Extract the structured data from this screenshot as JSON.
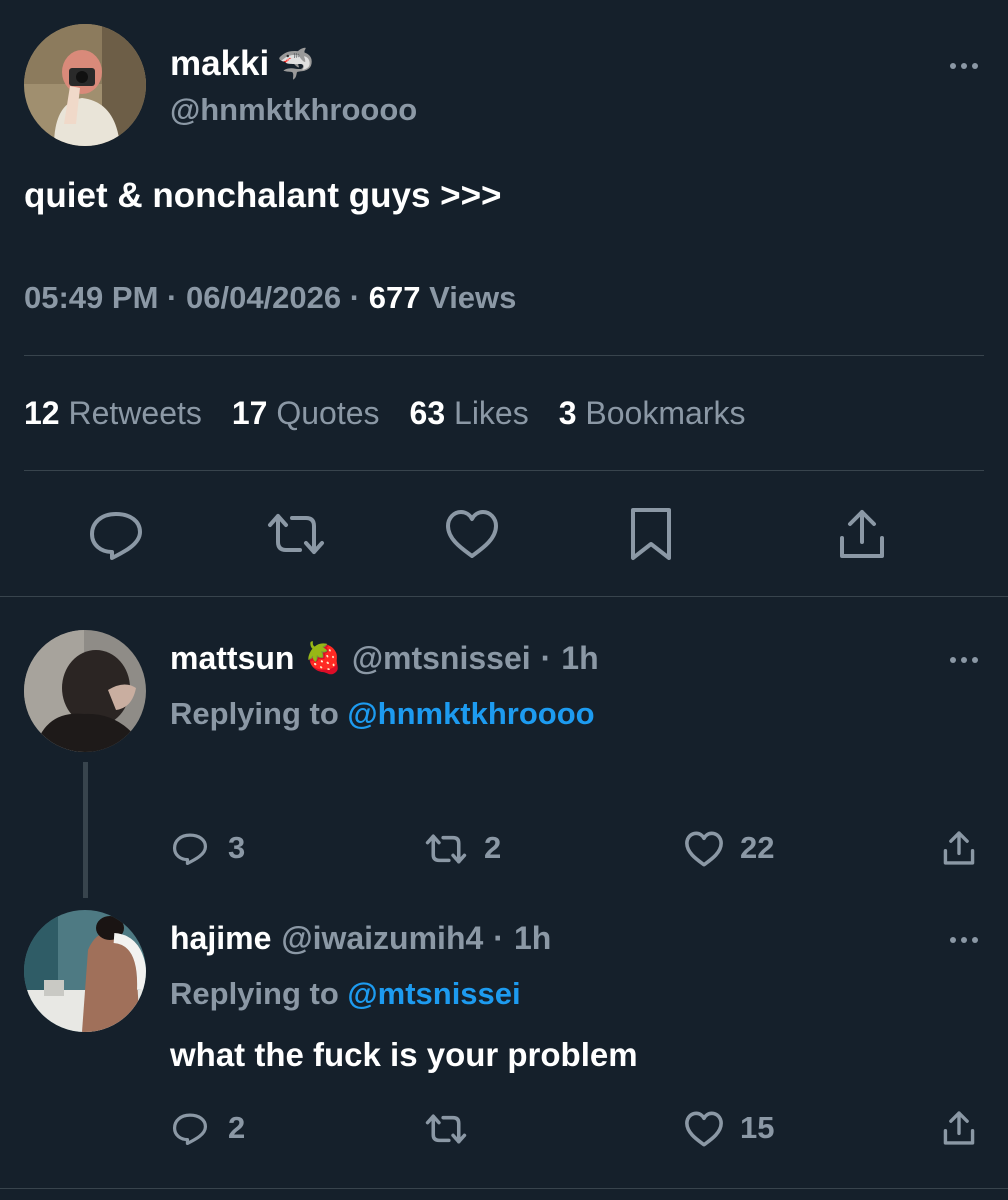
{
  "main_tweet": {
    "display_name": "makki",
    "name_emoji": "🦈",
    "handle": "@hnmktkhroooo",
    "text": "quiet & nonchalant guys >>>",
    "time": "05:49 PM",
    "separator": "·",
    "date": "06/04/2026",
    "views_count": "677",
    "views_label": "Views",
    "stats": [
      {
        "count": "12",
        "label": "Retweets"
      },
      {
        "count": "17",
        "label": "Quotes"
      },
      {
        "count": "63",
        "label": "Likes"
      },
      {
        "count": "3",
        "label": "Bookmarks"
      }
    ],
    "actions": [
      "reply-icon",
      "retweet-icon",
      "like-icon",
      "bookmark-icon",
      "share-icon"
    ]
  },
  "replies": [
    {
      "display_name": "mattsun",
      "name_emoji": "🍓",
      "handle": "@mtsnissei",
      "separator": "·",
      "time": "1h",
      "replying_prefix": "Replying to",
      "replying_handle": "@hnmktkhroooo",
      "text": "",
      "reply_count": "3",
      "retweet_count": "2",
      "like_count": "22"
    },
    {
      "display_name": "hajime",
      "handle": "@iwaizumih4",
      "separator": "·",
      "time": "1h",
      "replying_prefix": "Replying to",
      "replying_handle": "@mtsnissei",
      "text": "what the fuck is your problem",
      "reply_count": "2",
      "retweet_count": "",
      "like_count": "15"
    }
  ],
  "colors": {
    "background": "#15202b",
    "text": "#ffffff",
    "muted": "#8b98a5",
    "link": "#1d9bf0",
    "divider": "#38444d"
  }
}
